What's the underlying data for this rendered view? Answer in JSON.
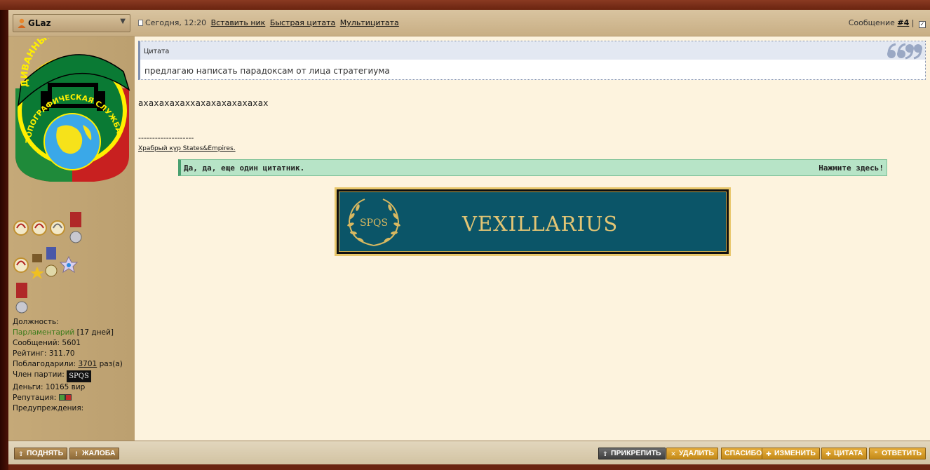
{
  "header": {
    "username": "GLaz",
    "date": "Сегодня, 12:20",
    "links": [
      "Вставить ник",
      "Быстрая цитата",
      "Мультицитата"
    ],
    "message_label": "Сообщение",
    "message_num": "#4",
    "separator": "|"
  },
  "emblem": {
    "top_text": "ДИВАННЫЕ ВОЙСКА",
    "ring_text": "ТОПОГРАФИЧЕСКАЯ СЛУЖБА"
  },
  "profile": {
    "position_label": "Должность:",
    "position_value": "Парламентарий",
    "position_days": "[17 дней]",
    "messages": "Сообщений: 5601",
    "rating": "Рейтинг: 311.70",
    "thanked_prefix": "Поблагодарили:",
    "thanked_count": "3701",
    "thanked_suffix": "раз(а)",
    "party_label": "Член партии:",
    "party_badge": "SPQS",
    "money": "Деньги: 10165 вир",
    "reputation_label": "Репутация:",
    "warnings": "Предупреждения:"
  },
  "quote": {
    "title": "Цитата",
    "text": "предлагаю написать парадоксам от лица стратегиума"
  },
  "post": {
    "text": "ахахахахаххахахахахахахах"
  },
  "signature": {
    "separator": "--------------------",
    "link": "Храбрый кур States&Empires.",
    "spoiler_text": "Да, да, еще один цитатник.",
    "spoiler_action": "Нажмите здесь!",
    "banner_wreath": "SPQS",
    "banner_text": "VEXILLARIUS"
  },
  "footer": {
    "raise": "ПОДНЯТЬ",
    "complain": "ЖАЛОБА",
    "pin": "ПРИКРЕПИТЬ",
    "delete": "УДАЛИТЬ",
    "thanks": "СПАСИБО",
    "edit": "ИЗМЕНИТЬ",
    "quote": "ЦИТАТА",
    "reply": "ОТВЕТИТЬ"
  },
  "colors": {
    "content_bg": "#fdf3de",
    "sidebar_bg": "#c5a978",
    "spoiler_bg": "#b7e4c7",
    "banner_teal": "#0b5568",
    "banner_gold": "#e3c574"
  }
}
